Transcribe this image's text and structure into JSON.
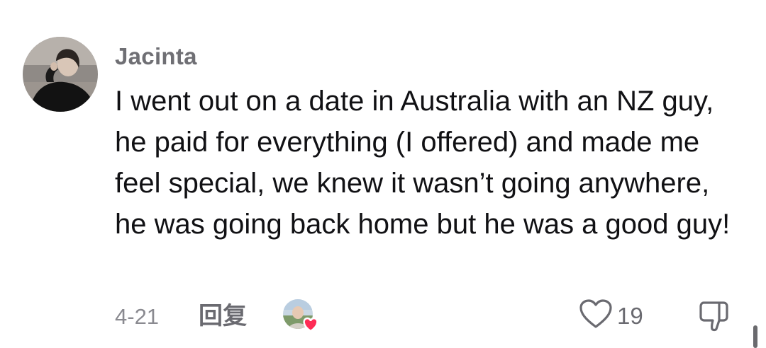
{
  "comment": {
    "username": "Jacinta",
    "text": "I went out on a date in Australia with an NZ guy, he paid for everything (I offered) and made me feel special, we knew it wasn’t going anywhere, he was going back home but he was a good guy!",
    "date": "4-21",
    "reply_label": "回复",
    "like_count": "19",
    "icons": {
      "avatar": "user-avatar",
      "reaction": "creator-liked-heart-icon",
      "like": "heart-outline-icon",
      "dislike": "thumbs-down-icon"
    }
  },
  "colors": {
    "username": "#6f6f74",
    "text": "#111114",
    "meta": "#8a8a90",
    "reaction_heart": "#fe2c55"
  }
}
